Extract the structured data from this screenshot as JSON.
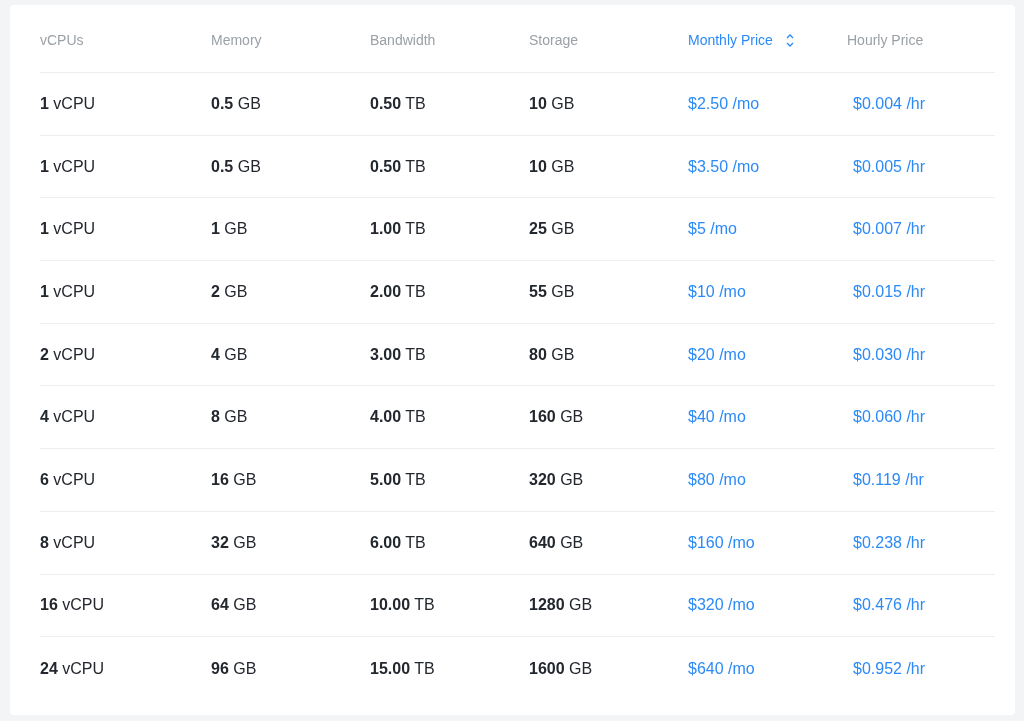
{
  "table": {
    "columns": [
      {
        "label": "vCPUs",
        "kind": "spec",
        "sorted": false
      },
      {
        "label": "Memory",
        "kind": "spec",
        "sorted": false
      },
      {
        "label": "Bandwidth",
        "kind": "spec",
        "sorted": false
      },
      {
        "label": "Storage",
        "kind": "spec",
        "sorted": false
      },
      {
        "label": "Monthly Price",
        "kind": "price",
        "sorted": true
      },
      {
        "label": "Hourly Price",
        "kind": "price",
        "sorted": false
      }
    ],
    "rows": [
      [
        "**1** vCPU",
        "**0.5** GB",
        "**0.50** TB",
        "**10** GB",
        "$2.50 /mo",
        "$0.004 /hr"
      ],
      [
        "**1** vCPU",
        "**0.5** GB",
        "**0.50** TB",
        "**10** GB",
        "$3.50 /mo",
        "$0.005 /hr"
      ],
      [
        "**1** vCPU",
        "**1** GB",
        "**1.00** TB",
        "**25** GB",
        "$5 /mo",
        "$0.007 /hr"
      ],
      [
        "**1** vCPU",
        "**2** GB",
        "**2.00** TB",
        "**55** GB",
        "$10 /mo",
        "$0.015 /hr"
      ],
      [
        "**2** vCPU",
        "**4** GB",
        "**3.00** TB",
        "**80** GB",
        "$20 /mo",
        "$0.030 /hr"
      ],
      [
        "**4** vCPU",
        "**8** GB",
        "**4.00** TB",
        "**160** GB",
        "$40 /mo",
        "$0.060 /hr"
      ],
      [
        "**6** vCPU",
        "**16** GB",
        "**5.00** TB",
        "**320** GB",
        "$80 /mo",
        "$0.119 /hr"
      ],
      [
        "**8** vCPU",
        "**32** GB",
        "**6.00** TB",
        "**640** GB",
        "$160 /mo",
        "$0.238 /hr"
      ],
      [
        "**16** vCPU",
        "**64** GB",
        "**10.00** TB",
        "**1280** GB",
        "$320 /mo",
        "$0.476 /hr"
      ],
      [
        "**24** vCPU",
        "**96** GB",
        "**15.00** TB",
        "**1600** GB",
        "$640 /mo",
        "$0.952 /hr"
      ]
    ]
  }
}
